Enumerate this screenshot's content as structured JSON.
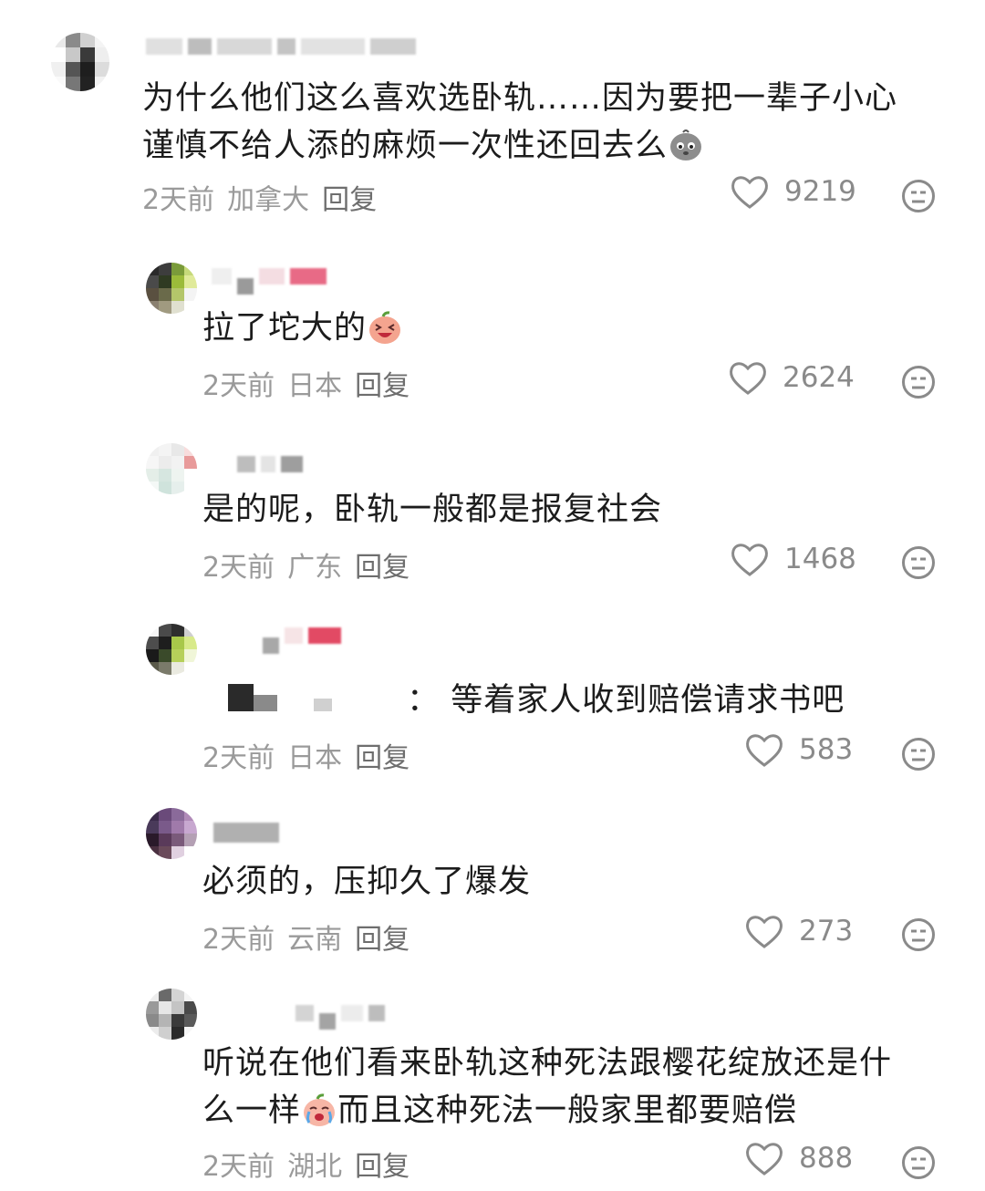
{
  "comments": [
    {
      "text_line1": "为什么他们这么喜欢选卧轨……因为要把一辈子小心",
      "text_line2": "谨慎不给人添的麻烦一次性还回去么",
      "emoji": "pensive-potato-emoji",
      "time": "2天前",
      "location": "加拿大",
      "reply": "回复",
      "likes": "9219"
    },
    {
      "text": "拉了坨大的",
      "emoji": "laughing-peach-emoji",
      "time": "2天前",
      "location": "日本",
      "reply": "回复",
      "likes": "2624"
    },
    {
      "text": "是的呢，卧轨一般都是报复社会",
      "time": "2天前",
      "location": "广东",
      "reply": "回复",
      "likes": "1468"
    },
    {
      "text": "：  等着家人收到赔偿请求书吧",
      "time": "2天前",
      "location": "日本",
      "reply": "回复",
      "likes": "583"
    },
    {
      "text": "必须的，压抑久了爆发",
      "time": "2天前",
      "location": "云南",
      "reply": "回复",
      "likes": "273"
    },
    {
      "text_line1": "听说在他们看来卧轨这种死法跟樱花绽放还是什",
      "text_line2a": "么一样",
      "text_line2b": "而且这种死法一般家里都要赔偿",
      "emoji": "crying-peach-emoji",
      "time": "2天前",
      "location": "湖北",
      "reply": "回复",
      "likes": "888"
    }
  ],
  "colors": {
    "text": "#1c1c1c",
    "meta": "#9a9a9a",
    "icon": "#8a8a8a"
  }
}
